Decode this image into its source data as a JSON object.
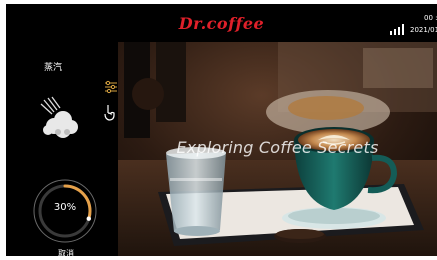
{
  "header": {
    "brand": "Dr.coffee",
    "brand_color": "#e0202a",
    "time": "00 :",
    "date": "2021/01",
    "signal_icon": "signal-bars-icon"
  },
  "left_panel": {
    "mode_label": "蒸汽",
    "mode_icon": "steam-icon",
    "progress": {
      "value_percent": 30,
      "text": "30%"
    },
    "cancel_label": "取消",
    "side_icons": [
      "settings-sliders-icon",
      "touch-hand-icon"
    ]
  },
  "hero": {
    "caption": "Exploring Coffee Secrets",
    "carousel": {
      "count": 3,
      "active_index": 0
    }
  }
}
